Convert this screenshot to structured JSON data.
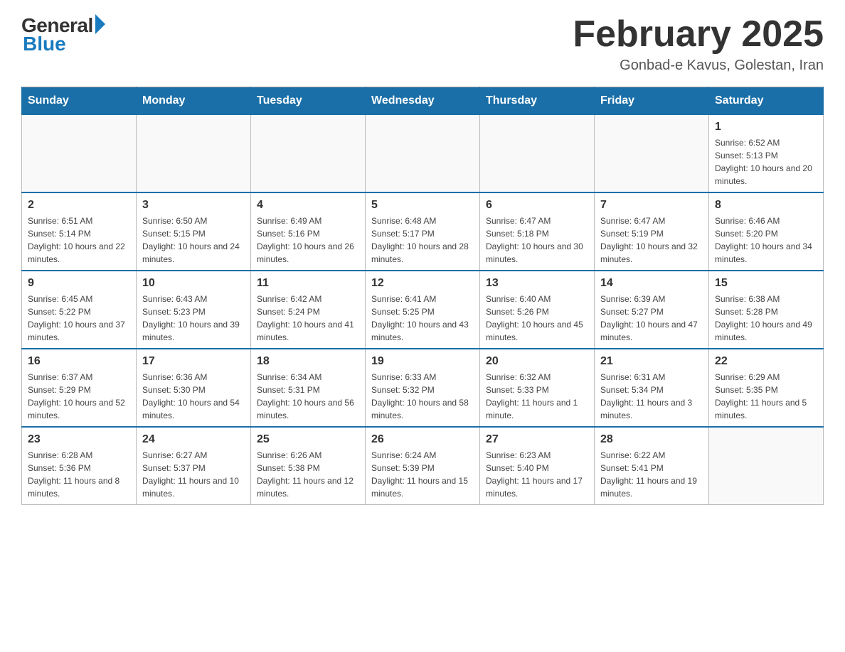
{
  "logo": {
    "general": "General",
    "blue": "Blue"
  },
  "title": "February 2025",
  "subtitle": "Gonbad-e Kavus, Golestan, Iran",
  "weekdays": [
    "Sunday",
    "Monday",
    "Tuesday",
    "Wednesday",
    "Thursday",
    "Friday",
    "Saturday"
  ],
  "weeks": [
    [
      {
        "day": "",
        "sunrise": "",
        "sunset": "",
        "daylight": ""
      },
      {
        "day": "",
        "sunrise": "",
        "sunset": "",
        "daylight": ""
      },
      {
        "day": "",
        "sunrise": "",
        "sunset": "",
        "daylight": ""
      },
      {
        "day": "",
        "sunrise": "",
        "sunset": "",
        "daylight": ""
      },
      {
        "day": "",
        "sunrise": "",
        "sunset": "",
        "daylight": ""
      },
      {
        "day": "",
        "sunrise": "",
        "sunset": "",
        "daylight": ""
      },
      {
        "day": "1",
        "sunrise": "Sunrise: 6:52 AM",
        "sunset": "Sunset: 5:13 PM",
        "daylight": "Daylight: 10 hours and 20 minutes."
      }
    ],
    [
      {
        "day": "2",
        "sunrise": "Sunrise: 6:51 AM",
        "sunset": "Sunset: 5:14 PM",
        "daylight": "Daylight: 10 hours and 22 minutes."
      },
      {
        "day": "3",
        "sunrise": "Sunrise: 6:50 AM",
        "sunset": "Sunset: 5:15 PM",
        "daylight": "Daylight: 10 hours and 24 minutes."
      },
      {
        "day": "4",
        "sunrise": "Sunrise: 6:49 AM",
        "sunset": "Sunset: 5:16 PM",
        "daylight": "Daylight: 10 hours and 26 minutes."
      },
      {
        "day": "5",
        "sunrise": "Sunrise: 6:48 AM",
        "sunset": "Sunset: 5:17 PM",
        "daylight": "Daylight: 10 hours and 28 minutes."
      },
      {
        "day": "6",
        "sunrise": "Sunrise: 6:47 AM",
        "sunset": "Sunset: 5:18 PM",
        "daylight": "Daylight: 10 hours and 30 minutes."
      },
      {
        "day": "7",
        "sunrise": "Sunrise: 6:47 AM",
        "sunset": "Sunset: 5:19 PM",
        "daylight": "Daylight: 10 hours and 32 minutes."
      },
      {
        "day": "8",
        "sunrise": "Sunrise: 6:46 AM",
        "sunset": "Sunset: 5:20 PM",
        "daylight": "Daylight: 10 hours and 34 minutes."
      }
    ],
    [
      {
        "day": "9",
        "sunrise": "Sunrise: 6:45 AM",
        "sunset": "Sunset: 5:22 PM",
        "daylight": "Daylight: 10 hours and 37 minutes."
      },
      {
        "day": "10",
        "sunrise": "Sunrise: 6:43 AM",
        "sunset": "Sunset: 5:23 PM",
        "daylight": "Daylight: 10 hours and 39 minutes."
      },
      {
        "day": "11",
        "sunrise": "Sunrise: 6:42 AM",
        "sunset": "Sunset: 5:24 PM",
        "daylight": "Daylight: 10 hours and 41 minutes."
      },
      {
        "day": "12",
        "sunrise": "Sunrise: 6:41 AM",
        "sunset": "Sunset: 5:25 PM",
        "daylight": "Daylight: 10 hours and 43 minutes."
      },
      {
        "day": "13",
        "sunrise": "Sunrise: 6:40 AM",
        "sunset": "Sunset: 5:26 PM",
        "daylight": "Daylight: 10 hours and 45 minutes."
      },
      {
        "day": "14",
        "sunrise": "Sunrise: 6:39 AM",
        "sunset": "Sunset: 5:27 PM",
        "daylight": "Daylight: 10 hours and 47 minutes."
      },
      {
        "day": "15",
        "sunrise": "Sunrise: 6:38 AM",
        "sunset": "Sunset: 5:28 PM",
        "daylight": "Daylight: 10 hours and 49 minutes."
      }
    ],
    [
      {
        "day": "16",
        "sunrise": "Sunrise: 6:37 AM",
        "sunset": "Sunset: 5:29 PM",
        "daylight": "Daylight: 10 hours and 52 minutes."
      },
      {
        "day": "17",
        "sunrise": "Sunrise: 6:36 AM",
        "sunset": "Sunset: 5:30 PM",
        "daylight": "Daylight: 10 hours and 54 minutes."
      },
      {
        "day": "18",
        "sunrise": "Sunrise: 6:34 AM",
        "sunset": "Sunset: 5:31 PM",
        "daylight": "Daylight: 10 hours and 56 minutes."
      },
      {
        "day": "19",
        "sunrise": "Sunrise: 6:33 AM",
        "sunset": "Sunset: 5:32 PM",
        "daylight": "Daylight: 10 hours and 58 minutes."
      },
      {
        "day": "20",
        "sunrise": "Sunrise: 6:32 AM",
        "sunset": "Sunset: 5:33 PM",
        "daylight": "Daylight: 11 hours and 1 minute."
      },
      {
        "day": "21",
        "sunrise": "Sunrise: 6:31 AM",
        "sunset": "Sunset: 5:34 PM",
        "daylight": "Daylight: 11 hours and 3 minutes."
      },
      {
        "day": "22",
        "sunrise": "Sunrise: 6:29 AM",
        "sunset": "Sunset: 5:35 PM",
        "daylight": "Daylight: 11 hours and 5 minutes."
      }
    ],
    [
      {
        "day": "23",
        "sunrise": "Sunrise: 6:28 AM",
        "sunset": "Sunset: 5:36 PM",
        "daylight": "Daylight: 11 hours and 8 minutes."
      },
      {
        "day": "24",
        "sunrise": "Sunrise: 6:27 AM",
        "sunset": "Sunset: 5:37 PM",
        "daylight": "Daylight: 11 hours and 10 minutes."
      },
      {
        "day": "25",
        "sunrise": "Sunrise: 6:26 AM",
        "sunset": "Sunset: 5:38 PM",
        "daylight": "Daylight: 11 hours and 12 minutes."
      },
      {
        "day": "26",
        "sunrise": "Sunrise: 6:24 AM",
        "sunset": "Sunset: 5:39 PM",
        "daylight": "Daylight: 11 hours and 15 minutes."
      },
      {
        "day": "27",
        "sunrise": "Sunrise: 6:23 AM",
        "sunset": "Sunset: 5:40 PM",
        "daylight": "Daylight: 11 hours and 17 minutes."
      },
      {
        "day": "28",
        "sunrise": "Sunrise: 6:22 AM",
        "sunset": "Sunset: 5:41 PM",
        "daylight": "Daylight: 11 hours and 19 minutes."
      },
      {
        "day": "",
        "sunrise": "",
        "sunset": "",
        "daylight": ""
      }
    ]
  ]
}
